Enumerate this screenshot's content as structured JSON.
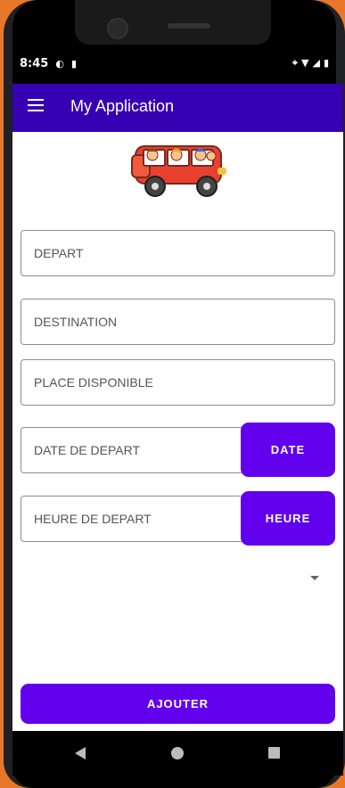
{
  "status_bar": {
    "time": "8:45",
    "left_icons": [
      "app-notification-icon",
      "clipboard-icon"
    ],
    "right_icons": [
      "location-icon",
      "wifi-icon",
      "signal-icon",
      "battery-icon"
    ]
  },
  "app_bar": {
    "title": "My Application",
    "menu_icon": "hamburger-menu-icon"
  },
  "hero": {
    "image": "van-with-passengers-illustration"
  },
  "form": {
    "depart_placeholder": "DEPART",
    "destination_placeholder": "DESTINATION",
    "places_placeholder": "PLACE DISPONIBLE",
    "date_placeholder": "DATE DE DEPART",
    "date_button": "DATE",
    "time_placeholder": "HEURE DE DEPART",
    "time_button": "HEURE",
    "dropdown_icon": "dropdown-arrow-icon"
  },
  "actions": {
    "submit_label": "AJOUTER"
  },
  "colors": {
    "primary": "#6200ee",
    "app_bar": "#3700b3",
    "background": "#ffffff",
    "border": "#8d8d8d"
  }
}
